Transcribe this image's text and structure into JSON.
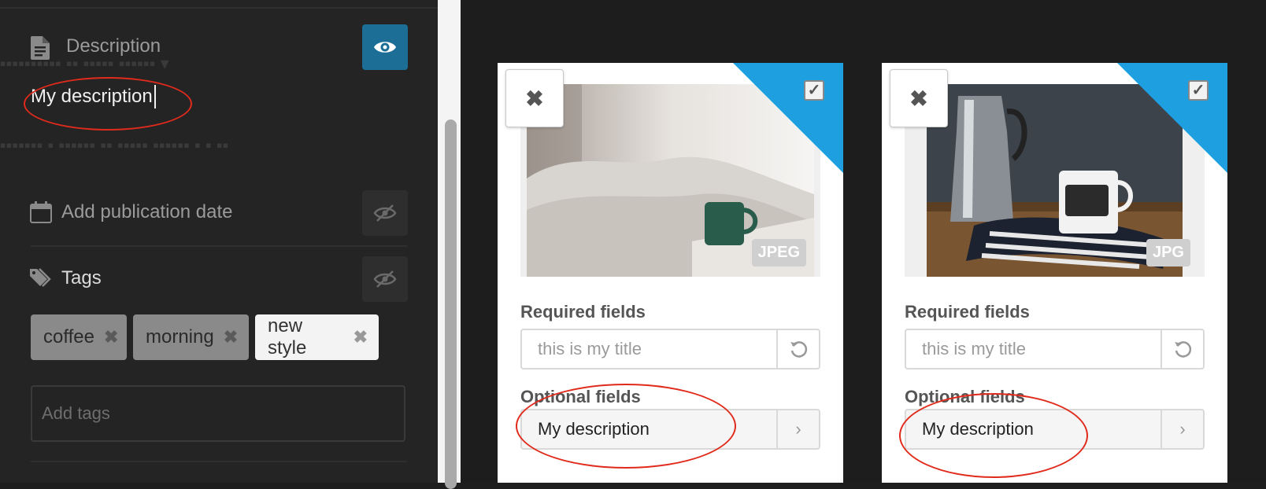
{
  "left_panel": {
    "description": {
      "title": "Description",
      "value": "My description",
      "visibility_icon": "eye-icon"
    },
    "publication_date": {
      "label": "Add publication date",
      "visibility_icon": "eye-slash-icon"
    },
    "tags": {
      "title": "Tags",
      "visibility_icon": "eye-slash-icon",
      "items": [
        {
          "label": "coffee"
        },
        {
          "label": "morning"
        },
        {
          "label": "new style"
        }
      ],
      "add_placeholder": "Add tags"
    }
  },
  "cards": [
    {
      "format": "JPEG",
      "required_label": "Required fields",
      "title_placeholder": "this is my title",
      "optional_label": "Optional fields",
      "description": "My description"
    },
    {
      "format": "JPG",
      "required_label": "Required fields",
      "title_placeholder": "this is my title",
      "optional_label": "Optional fields",
      "description": "My description"
    }
  ],
  "colors": {
    "accent": "#1c6e96",
    "ribbon": "#1e9fe0",
    "annotation": "#e02b1c"
  }
}
